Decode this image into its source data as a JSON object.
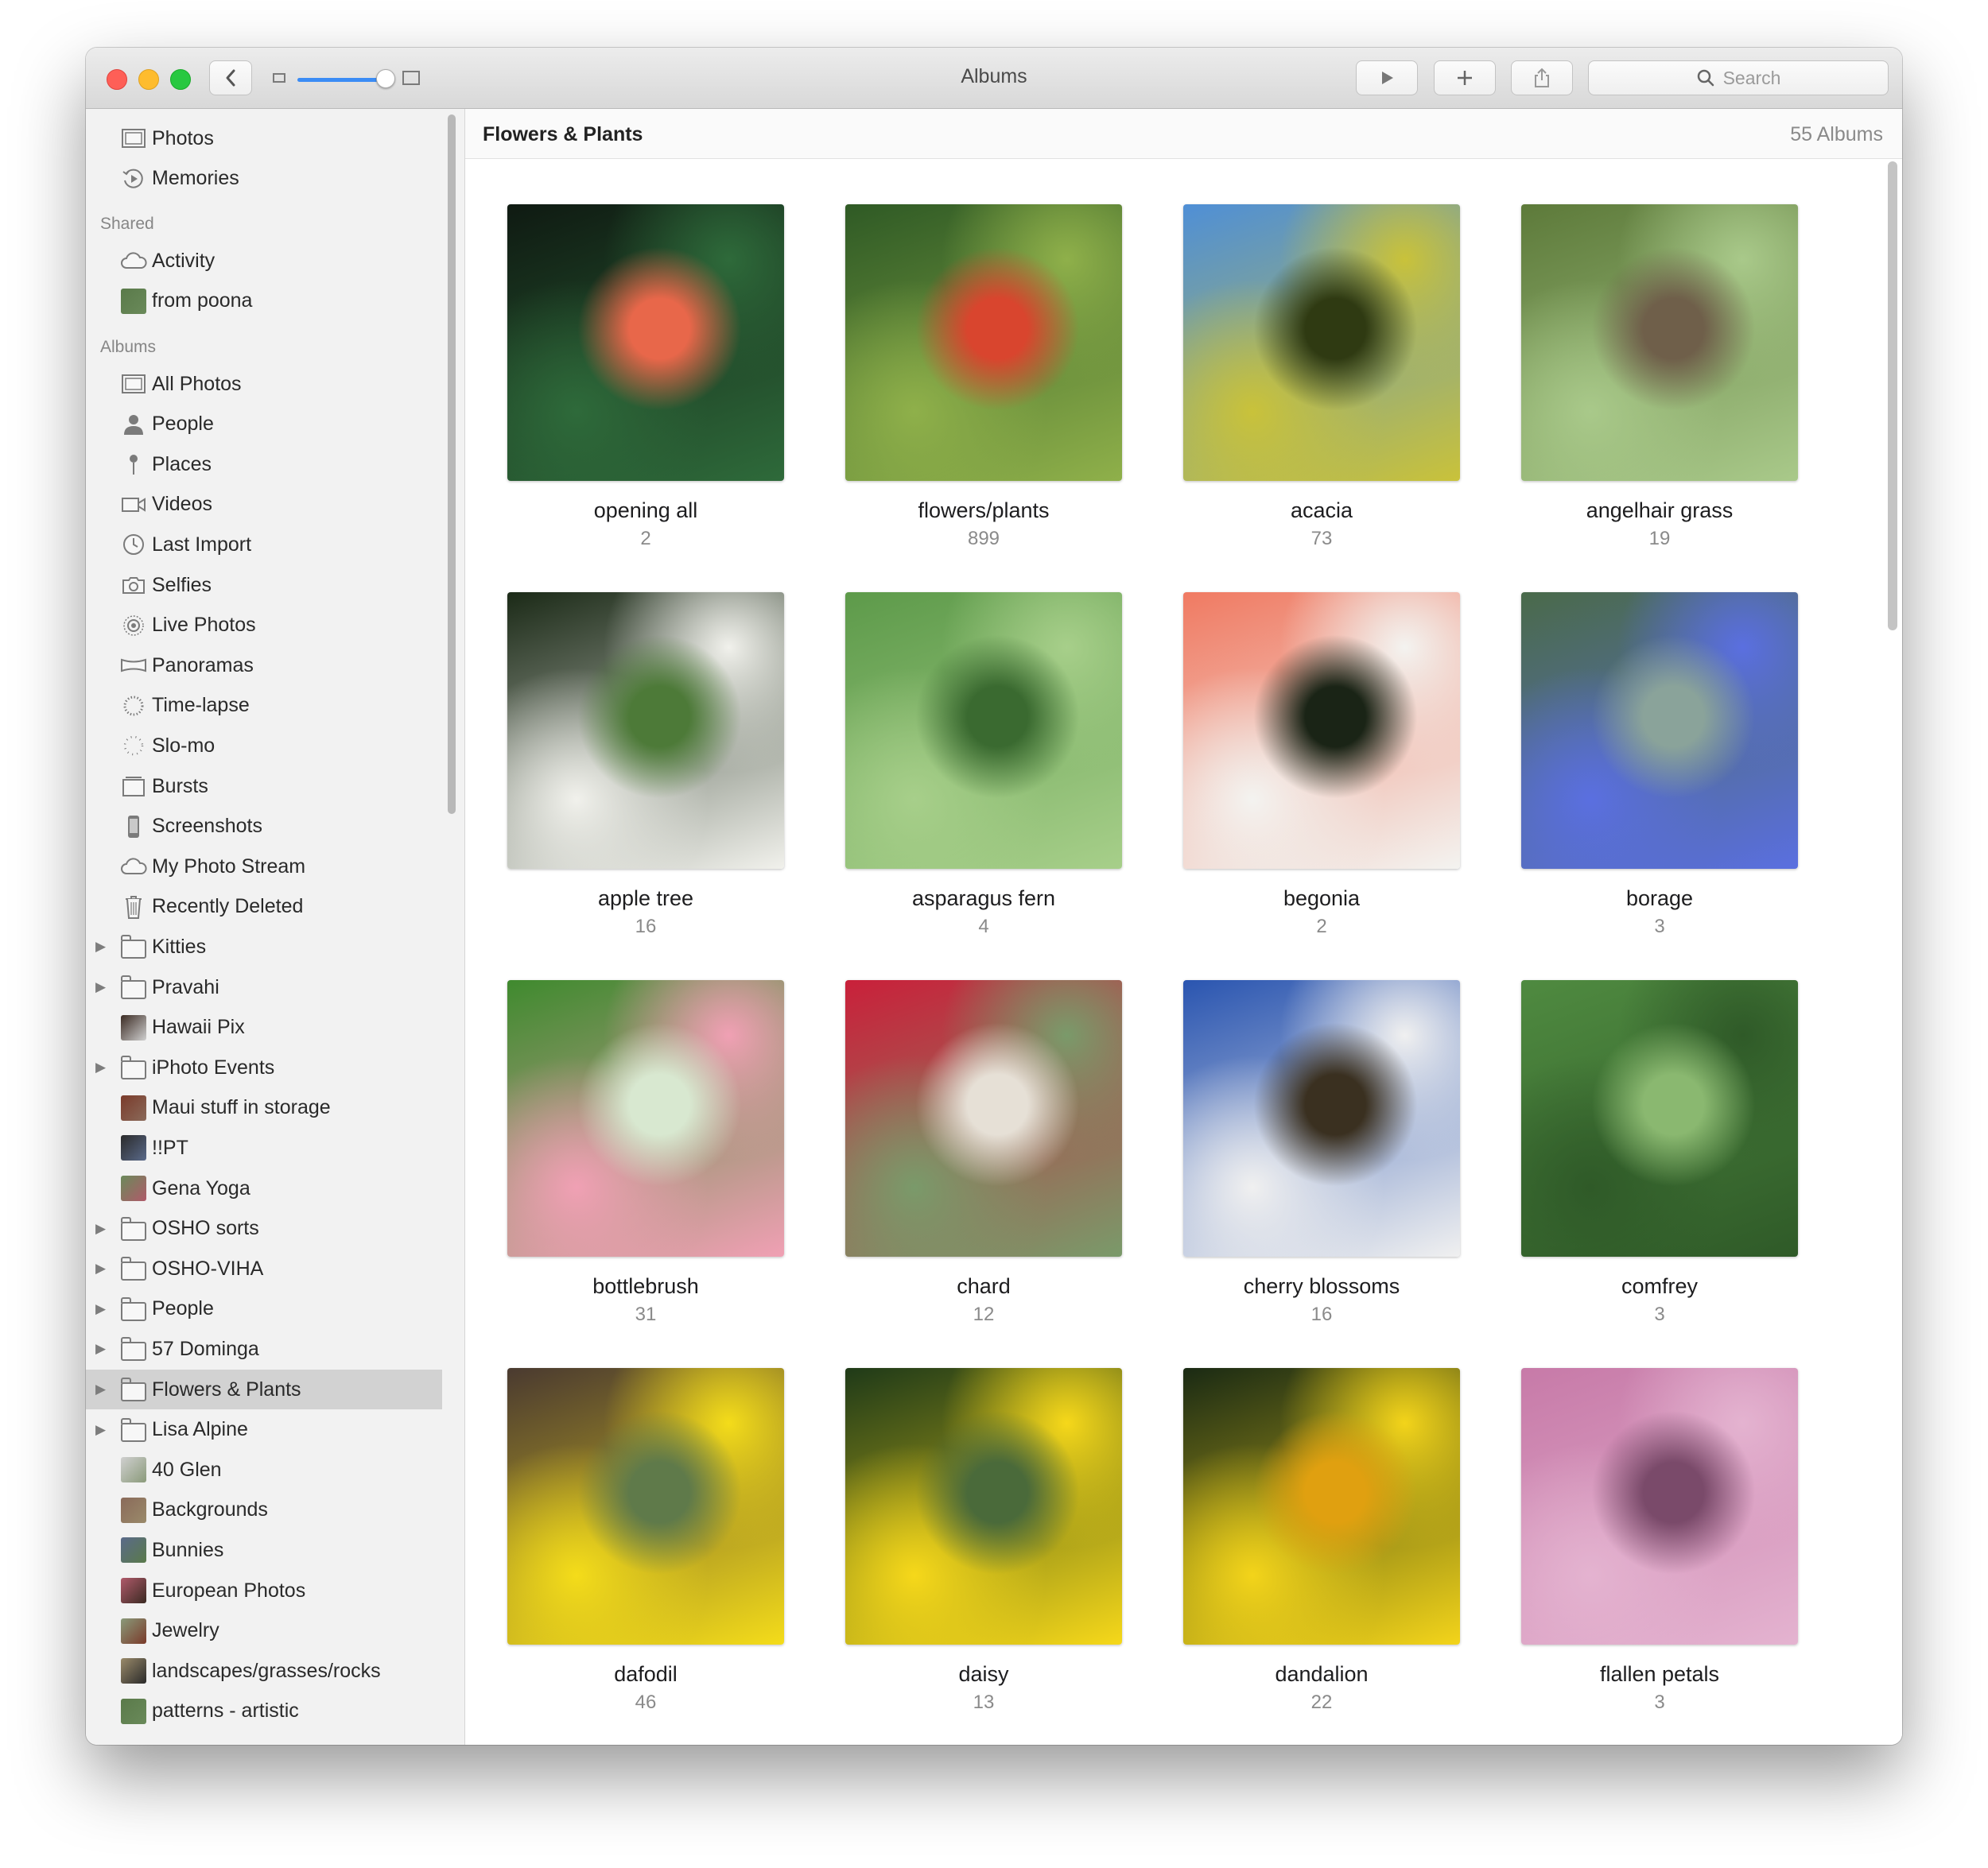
{
  "window": {
    "title": "Albums"
  },
  "toolbar": {
    "search_placeholder": "Search"
  },
  "sidebar": {
    "top_items": [
      {
        "label": "Photos",
        "icon": "photos-icon"
      },
      {
        "label": "Memories",
        "icon": "memories-icon"
      }
    ],
    "shared_heading": "Shared",
    "shared_items": [
      {
        "label": "Activity",
        "icon": "cloud-icon"
      },
      {
        "label": "from poona",
        "icon": "album-thumbnail-icon"
      }
    ],
    "albums_heading": "Albums",
    "album_items": [
      {
        "label": "All Photos",
        "icon": "photos-icon"
      },
      {
        "label": "People",
        "icon": "person-icon"
      },
      {
        "label": "Places",
        "icon": "pin-icon"
      },
      {
        "label": "Videos",
        "icon": "video-icon"
      },
      {
        "label": "Last Import",
        "icon": "clock-icon"
      },
      {
        "label": "Selfies",
        "icon": "camera-icon"
      },
      {
        "label": "Live Photos",
        "icon": "live-photo-icon"
      },
      {
        "label": "Panoramas",
        "icon": "panorama-icon"
      },
      {
        "label": "Time-lapse",
        "icon": "timelapse-icon"
      },
      {
        "label": "Slo-mo",
        "icon": "slomo-icon"
      },
      {
        "label": "Bursts",
        "icon": "bursts-icon"
      },
      {
        "label": "Screenshots",
        "icon": "phone-icon"
      },
      {
        "label": "My Photo Stream",
        "icon": "cloud-icon"
      },
      {
        "label": "Recently Deleted",
        "icon": "trash-icon"
      },
      {
        "label": "Kitties",
        "icon": "folder-icon",
        "disclosure": true
      },
      {
        "label": "Pravahi",
        "icon": "folder-icon",
        "disclosure": true
      },
      {
        "label": "Hawaii Pix",
        "icon": "album-thumbnail-icon"
      },
      {
        "label": "iPhoto Events",
        "icon": "folder-icon",
        "disclosure": true
      },
      {
        "label": "Maui stuff in storage",
        "icon": "album-thumbnail-icon"
      },
      {
        "label": "!!PT",
        "icon": "album-thumbnail-icon"
      },
      {
        "label": "Gena Yoga",
        "icon": "album-thumbnail-icon"
      },
      {
        "label": "OSHO sorts",
        "icon": "folder-icon",
        "disclosure": true
      },
      {
        "label": "OSHO-VIHA",
        "icon": "folder-icon",
        "disclosure": true
      },
      {
        "label": "People",
        "icon": "folder-icon",
        "disclosure": true
      },
      {
        "label": "57 Dominga",
        "icon": "folder-icon",
        "disclosure": true
      },
      {
        "label": "Flowers & Plants",
        "icon": "folder-icon",
        "disclosure": true,
        "selected": true
      },
      {
        "label": "Lisa Alpine",
        "icon": "folder-icon",
        "disclosure": true
      },
      {
        "label": "40 Glen",
        "icon": "album-thumbnail-icon"
      },
      {
        "label": "Backgrounds",
        "icon": "album-thumbnail-icon"
      },
      {
        "label": "Bunnies",
        "icon": "album-thumbnail-icon"
      },
      {
        "label": "European Photos",
        "icon": "album-thumbnail-icon"
      },
      {
        "label": "Jewelry",
        "icon": "album-thumbnail-icon"
      },
      {
        "label": "landscapes/grasses/rocks",
        "icon": "album-thumbnail-icon"
      },
      {
        "label": "patterns - artistic",
        "icon": "album-thumbnail-icon"
      }
    ]
  },
  "content": {
    "title": "Flowers & Plants",
    "count_label": "55 Albums",
    "albums": [
      {
        "name": "opening all",
        "count": "2",
        "colors": [
          "#0f1a12",
          "#2e6a3a",
          "#e8674a"
        ]
      },
      {
        "name": "flowers/plants",
        "count": "899",
        "colors": [
          "#2f5a25",
          "#8fb04a",
          "#d9452e"
        ]
      },
      {
        "name": "acacia",
        "count": "73",
        "colors": [
          "#4f8fd6",
          "#c9c23a",
          "#2f3a12"
        ]
      },
      {
        "name": "angelhair grass",
        "count": "19",
        "colors": [
          "#5d7a3a",
          "#a9c98a",
          "#6f5f4a"
        ]
      },
      {
        "name": "apple tree",
        "count": "16",
        "colors": [
          "#1b2a17",
          "#f1f1ec",
          "#4d7a38"
        ]
      },
      {
        "name": "asparagus fern",
        "count": "4",
        "colors": [
          "#5d9a4a",
          "#a7cf8a",
          "#3a6a30"
        ]
      },
      {
        "name": "begonia",
        "count": "2",
        "colors": [
          "#f07a62",
          "#f3f3f0",
          "#1a2416"
        ]
      },
      {
        "name": "borage",
        "count": "3",
        "colors": [
          "#4a6a4a",
          "#5a6fe0",
          "#8aa39a"
        ]
      },
      {
        "name": "bottlebrush",
        "count": "31",
        "colors": [
          "#3f8a2e",
          "#f0a0b4",
          "#d8e8d0"
        ]
      },
      {
        "name": "chard",
        "count": "12",
        "colors": [
          "#c9203a",
          "#7a9a6a",
          "#e6e0d6"
        ]
      },
      {
        "name": "cherry blossoms",
        "count": "16",
        "colors": [
          "#2a55b0",
          "#f0f0f0",
          "#3a3020"
        ]
      },
      {
        "name": "comfrey",
        "count": "3",
        "colors": [
          "#4f8a40",
          "#2f5a28",
          "#8ab870"
        ]
      },
      {
        "name": "dafodil",
        "count": "46",
        "colors": [
          "#4a3a30",
          "#f4dc1a",
          "#5f7a4a"
        ]
      },
      {
        "name": "daisy",
        "count": "13",
        "colors": [
          "#1f3a18",
          "#f6d81a",
          "#4a6a3a"
        ]
      },
      {
        "name": "dandalion",
        "count": "22",
        "colors": [
          "#1a2a14",
          "#f3d41a",
          "#e0a010"
        ]
      },
      {
        "name": "flallen petals",
        "count": "3",
        "colors": [
          "#c77aa8",
          "#e4b3d0",
          "#7a4a6a"
        ]
      }
    ]
  }
}
